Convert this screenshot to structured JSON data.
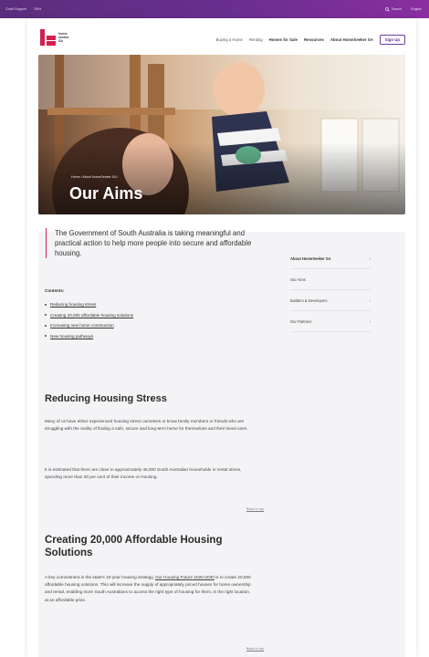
{
  "topbar": {
    "left_links": [
      "Covid Support",
      "TAFe"
    ],
    "search_label": "Search",
    "lang_label": "English"
  },
  "brand": {
    "line1": "home",
    "line2": "seeker",
    "line3": "SA"
  },
  "nav": {
    "items": [
      "Buying a Home",
      "Renting",
      "Homes for Sale",
      "Resources",
      "About HomeSeeker SA"
    ],
    "signup": "Sign Up"
  },
  "hero": {
    "breadcrumb": "Home  /  About HomeSeeker SA  /",
    "title": "Our Aims"
  },
  "intro": "The Government of South Australia is taking meaningful and practical action to help more people into secure and affordable housing.",
  "contents": {
    "heading": "Contents:",
    "items": [
      "Reducing housing stress",
      "Creating 20,000 affordable housing solutions",
      "Increasing new home construction",
      "New housing pathways"
    ]
  },
  "sections": [
    {
      "heading": "Reducing Housing Stress",
      "paragraphs": [
        "Many of us have either experienced housing stress ourselves or know family members or friends who are struggling with the reality of finding a safe, secure and long-term home for themselves and their loved ones.",
        "It is estimated that there are close to approximately 46,000 South Australian households in rental stress, spending more than 30 per cent of their income on housing."
      ],
      "back_to_top": "Back to top"
    },
    {
      "heading": "Creating 20,000 Affordable Housing Solutions",
      "paragraph_before_link": "A key commitment in the state's 10-year housing strategy,",
      "link": "Our Housing Future 2020-2030",
      "paragraph_after_link": "is to create 20,000 affordable housing solutions. This will increase the supply of appropriately priced houses for home ownership and rental, enabling more South Australians to access the right type of housing for them, in the right location, at an affordable price.",
      "back_to_top": "Back to top"
    }
  ],
  "sidebar": {
    "items": [
      {
        "label": "About HomeSeeker SA",
        "chevron": "›"
      },
      {
        "label": "Our Aims",
        "chevron": ""
      },
      {
        "label": "Builders & Developers",
        "chevron": "›"
      },
      {
        "label": "Our Partners",
        "chevron": "›"
      }
    ]
  },
  "colors": {
    "brand_red": "#d1204d",
    "topbar_purple": "#5b2d7e"
  }
}
